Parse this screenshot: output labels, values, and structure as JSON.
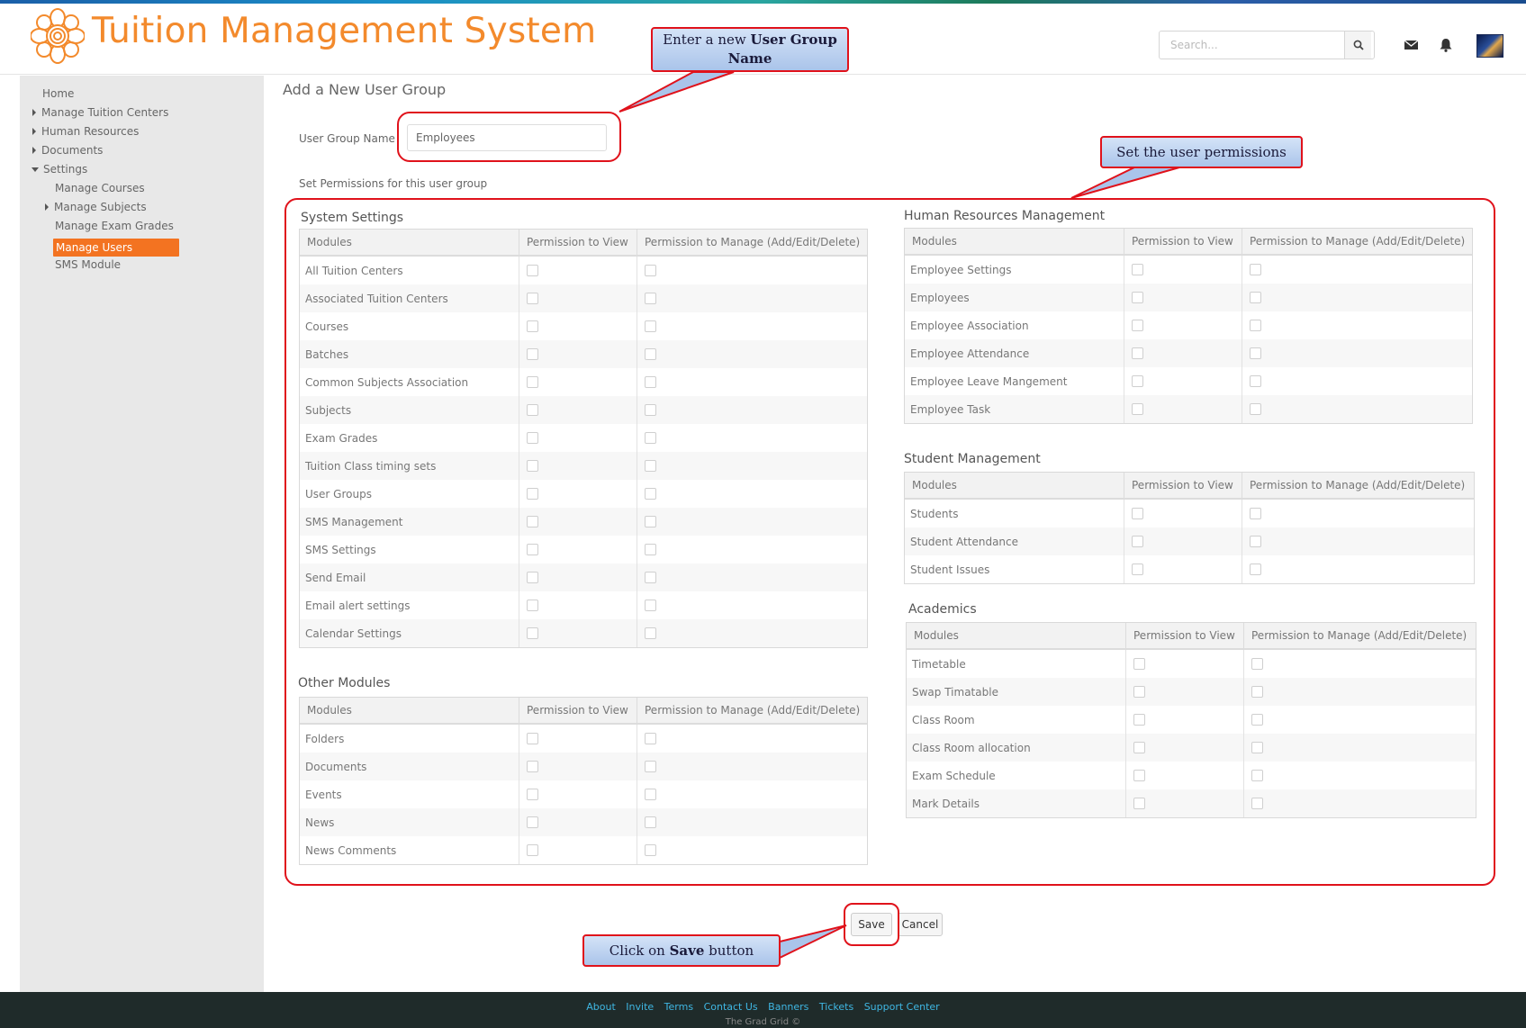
{
  "header": {
    "app_title": "Tuition Management System",
    "search_placeholder": "Search..."
  },
  "sidebar": {
    "items": [
      {
        "label": "Home"
      },
      {
        "label": "Manage Tuition Centers"
      },
      {
        "label": "Human Resources"
      },
      {
        "label": "Documents"
      },
      {
        "label": "Settings"
      },
      {
        "label": "Manage Courses"
      },
      {
        "label": "Manage Subjects"
      },
      {
        "label": "Manage Exam Grades"
      },
      {
        "label": "Manage Users"
      },
      {
        "label": "SMS Module"
      }
    ]
  },
  "main": {
    "title": "Add a New User Group",
    "group_name_label": "User Group Name",
    "group_name_value": "Employees",
    "permissions_label": "Set Permissions for this user group",
    "col_modules": "Modules",
    "col_view": "Permission to View",
    "col_manage": "Permission to Manage (Add/Edit/Delete)",
    "sections": {
      "system": {
        "title": "System Settings",
        "rows": [
          "All Tuition Centers",
          "Associated Tuition Centers",
          "Courses",
          "Batches",
          "Common Subjects Association",
          "Subjects",
          "Exam Grades",
          "Tuition Class timing sets",
          "User Groups",
          "SMS Management",
          "SMS Settings",
          "Send Email",
          "Email alert settings",
          "Calendar Settings"
        ]
      },
      "other": {
        "title": "Other Modules",
        "rows": [
          "Folders",
          "Documents",
          "Events",
          "News",
          "News Comments"
        ]
      },
      "hr": {
        "title": "Human Resources Management",
        "rows": [
          "Employee Settings",
          "Employees",
          "Employee Association",
          "Employee Attendance",
          "Employee Leave Mangement",
          "Employee Task"
        ]
      },
      "student": {
        "title": "Student Management",
        "rows": [
          "Students",
          "Student Attendance",
          "Student Issues"
        ]
      },
      "academics": {
        "title": "Academics",
        "rows": [
          "Timetable",
          "Swap Timatable",
          "Class Room",
          "Class Room allocation",
          "Exam Schedule",
          "Mark Details"
        ]
      }
    },
    "save_label": "Save",
    "cancel_label": "Cancel"
  },
  "annotations": {
    "callout_group_name_pre": "Enter a new ",
    "callout_group_name_bold": "User Group Name",
    "callout_permissions": "Set the user permissions",
    "callout_save_pre": "Click on ",
    "callout_save_bold": "Save",
    "callout_save_post": " button"
  },
  "footer": {
    "links": [
      "About",
      "Invite",
      "Terms",
      "Contact Us",
      "Banners",
      "Tickets",
      "Support Center"
    ],
    "copyright": "The Grad Grid ©"
  },
  "colors": {
    "brand_orange": "#f38a2c",
    "active_item": "#f37321",
    "annotation_red": "#e0121b",
    "footer_bg": "#1f2b2a",
    "footer_link": "#3fb7e3"
  }
}
